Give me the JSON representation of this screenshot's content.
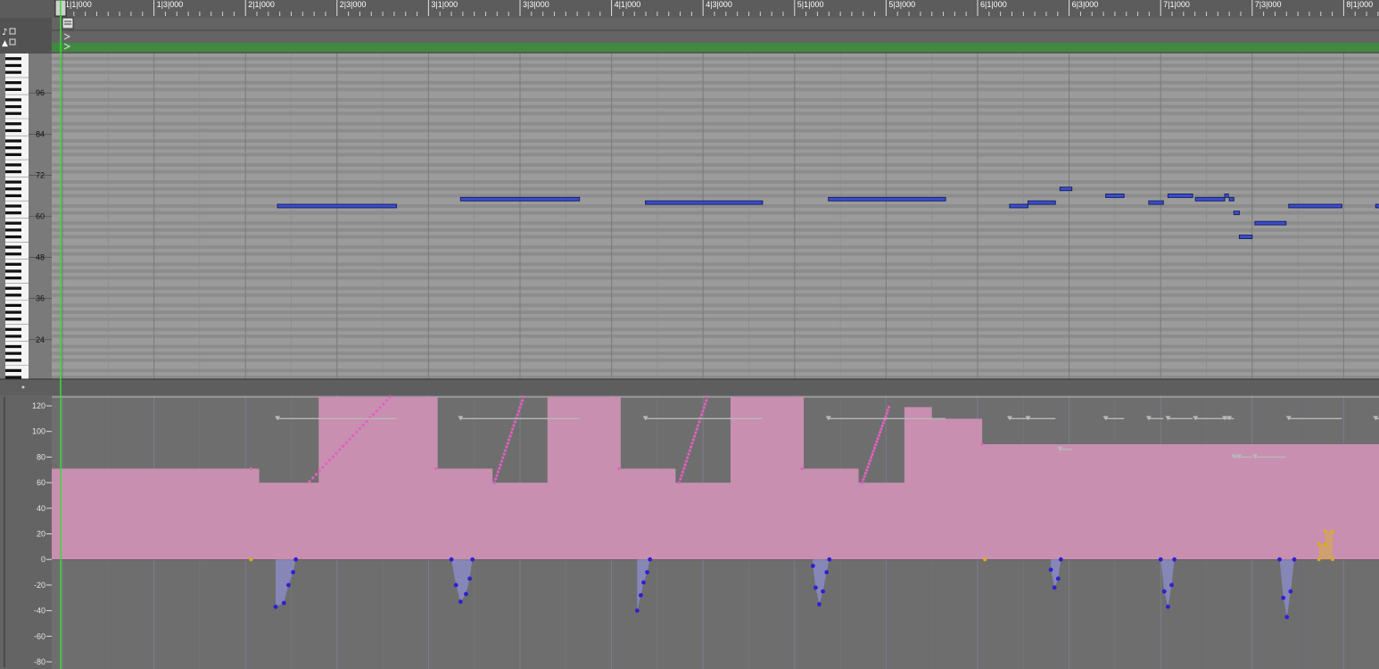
{
  "colors": {
    "ruler_bg": "#5c5c5c",
    "grid_bg": "#9b9b9b",
    "grid_stripe": "#8c8c8c",
    "note_fill": "#3c4fc9",
    "note_border": "#15206b",
    "velocity_fill": "#c88fb0",
    "velocity_point": "#e060c0",
    "pitchbend_fill": "#8f8fd0",
    "pitchbend_point": "#3020d0",
    "aftertouch_fill": "#d0a070",
    "aftertouch_point": "#e0b000",
    "playhead": "#33dd33",
    "region_bar": "#3f8a3f"
  },
  "ruler": {
    "markers": [
      "1|1|000",
      "1|3|000",
      "2|1|000",
      "2|3|000",
      "3|1|000",
      "3|3|000",
      "4|1|000",
      "4|3|000",
      "5|1|000",
      "5|3|000",
      "6|1|000",
      "6|3|000",
      "7|1|000",
      "7|3|000",
      "8|1|000"
    ]
  },
  "piano": {
    "labels": [
      "96",
      "84",
      "72",
      "60",
      "48",
      "36",
      "24"
    ],
    "pitch_range": [
      13,
      107
    ]
  },
  "notes": [
    {
      "start": 2.35,
      "end": 3.65,
      "pitch": 63
    },
    {
      "start": 4.35,
      "end": 5.65,
      "pitch": 65
    },
    {
      "start": 6.37,
      "end": 7.65,
      "pitch": 64
    },
    {
      "start": 8.37,
      "end": 9.65,
      "pitch": 65
    },
    {
      "start": 10.35,
      "end": 10.55,
      "pitch": 63
    },
    {
      "start": 10.55,
      "end": 10.85,
      "pitch": 64
    },
    {
      "start": 10.9,
      "end": 11.03,
      "pitch": 68
    },
    {
      "start": 11.4,
      "end": 11.6,
      "pitch": 66
    },
    {
      "start": 11.87,
      "end": 12.03,
      "pitch": 64
    },
    {
      "start": 12.08,
      "end": 12.35,
      "pitch": 66
    },
    {
      "start": 12.38,
      "end": 12.7,
      "pitch": 65
    },
    {
      "start": 12.7,
      "end": 12.74,
      "pitch": 66
    },
    {
      "start": 12.75,
      "end": 12.8,
      "pitch": 65
    },
    {
      "start": 12.8,
      "end": 12.86,
      "pitch": 61
    },
    {
      "start": 12.86,
      "end": 13.0,
      "pitch": 54
    },
    {
      "start": 13.03,
      "end": 13.37,
      "pitch": 58
    },
    {
      "start": 13.4,
      "end": 13.98,
      "pitch": 63
    },
    {
      "start": 14.35,
      "end": 14.5,
      "pitch": 63
    }
  ],
  "controller": {
    "labels": [
      "120",
      "100",
      "80",
      "60",
      "40",
      "20",
      "0",
      "-20",
      "-40",
      "-60",
      "-80"
    ],
    "range": [
      -80,
      120
    ]
  },
  "velocity": [
    [
      0.0,
      71
    ],
    [
      2.15,
      71
    ],
    [
      2.15,
      60
    ],
    [
      2.8,
      60
    ],
    [
      2.8,
      127
    ],
    [
      4.1,
      127
    ],
    [
      4.1,
      71
    ],
    [
      4.7,
      71
    ],
    [
      4.7,
      60
    ],
    [
      5.3,
      60
    ],
    [
      5.3,
      127
    ],
    [
      6.1,
      127
    ],
    [
      6.1,
      71
    ],
    [
      6.7,
      71
    ],
    [
      6.7,
      60
    ],
    [
      7.3,
      60
    ],
    [
      7.3,
      127
    ],
    [
      8.1,
      127
    ],
    [
      8.1,
      71
    ],
    [
      8.7,
      71
    ],
    [
      8.7,
      60
    ],
    [
      9.2,
      60
    ],
    [
      9.2,
      119
    ],
    [
      9.5,
      119
    ],
    [
      9.5,
      110
    ],
    [
      10.05,
      110
    ],
    [
      10.05,
      90
    ],
    [
      14.5,
      90
    ]
  ],
  "velocity_ramps": [
    [
      2.7,
      4.3,
      61,
      127
    ],
    [
      4.72,
      5.3,
      60,
      127
    ],
    [
      6.74,
      7.3,
      60,
      127
    ],
    [
      8.74,
      9.27,
      60,
      119
    ]
  ],
  "velocity_dots": [
    [
      2.06,
      71
    ],
    [
      4.08,
      71
    ],
    [
      6.08,
      71
    ],
    [
      8.08,
      71
    ],
    [
      10.05,
      90
    ]
  ],
  "pitchbend_groups": [
    [
      [
        2.33,
        -37
      ],
      [
        2.42,
        -34
      ],
      [
        2.47,
        -20
      ],
      [
        2.52,
        -10
      ],
      [
        2.55,
        0
      ]
    ],
    [
      [
        4.25,
        0
      ],
      [
        4.3,
        -20
      ],
      [
        4.35,
        -33
      ],
      [
        4.41,
        -27
      ],
      [
        4.45,
        -15
      ],
      [
        4.48,
        0
      ]
    ],
    [
      [
        6.28,
        -40
      ],
      [
        6.32,
        -28
      ],
      [
        6.35,
        -18
      ],
      [
        6.39,
        -10
      ],
      [
        6.42,
        0
      ]
    ],
    [
      [
        8.2,
        -5
      ],
      [
        8.23,
        -22
      ],
      [
        8.27,
        -35
      ],
      [
        8.31,
        -25
      ],
      [
        8.35,
        -10
      ],
      [
        8.38,
        0
      ]
    ],
    [
      [
        10.8,
        -8
      ],
      [
        10.84,
        -22
      ],
      [
        10.88,
        -15
      ],
      [
        10.91,
        0
      ]
    ],
    [
      [
        12.0,
        0
      ],
      [
        12.04,
        -25
      ],
      [
        12.08,
        -37
      ],
      [
        12.12,
        -20
      ],
      [
        12.15,
        0
      ]
    ],
    [
      [
        13.3,
        0
      ],
      [
        13.34,
        -30
      ],
      [
        13.38,
        -45
      ],
      [
        13.42,
        -25
      ],
      [
        13.46,
        0
      ]
    ]
  ],
  "aftertouch": [
    [
      13.73,
      0
    ],
    [
      13.73,
      12
    ],
    [
      13.8,
      12
    ],
    [
      13.8,
      22
    ],
    [
      13.88,
      22
    ],
    [
      13.88,
      0
    ]
  ]
}
